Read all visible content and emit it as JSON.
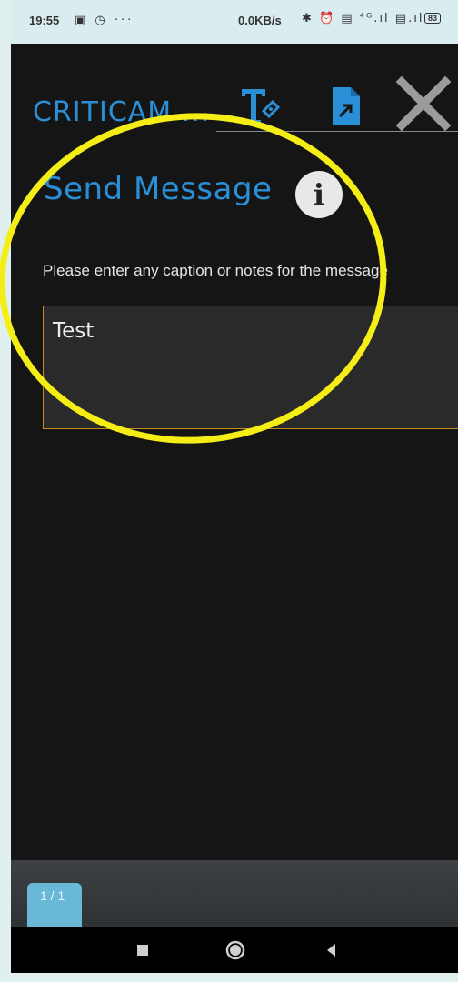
{
  "status_bar": {
    "time": "19:55",
    "left_icons": "▣ ◷ ···",
    "speed": "0.0KB/s",
    "right_icons": "✱ ⏰ ▤ ⁴ᴳ.ıl ▤.ıl",
    "battery": "83"
  },
  "header": {
    "app_title": "CRITICAM ...",
    "icons": [
      "text-annotate-icon",
      "document-export-icon",
      "close-icon"
    ]
  },
  "dialog": {
    "title": "Send Message",
    "info_glyph": "i",
    "prompt": "Please enter any caption or notes for the message",
    "input_value": "Test"
  },
  "footer": {
    "page_indicator": "1 / 1"
  },
  "nav": {
    "buttons": [
      "recents-button",
      "home-button",
      "back-button"
    ]
  },
  "colors": {
    "accent_blue": "#2a8fd6",
    "input_border": "#c98a16",
    "annotation_yellow": "#f4ee16",
    "page_badge": "#6ab8d8",
    "app_bg": "#151515"
  }
}
